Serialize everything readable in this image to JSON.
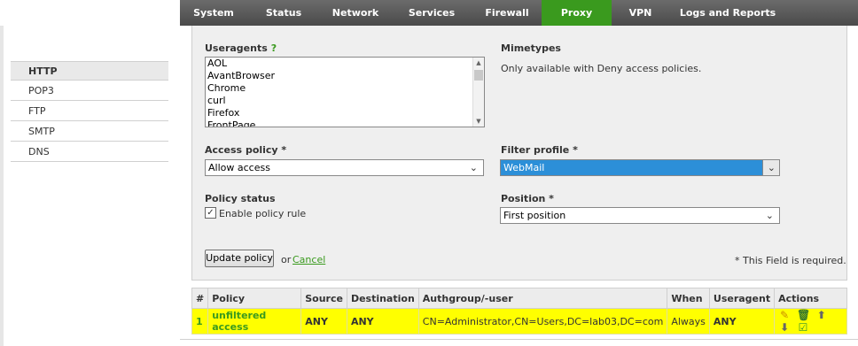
{
  "nav": {
    "items": [
      {
        "label": "System"
      },
      {
        "label": "Status"
      },
      {
        "label": "Network"
      },
      {
        "label": "Services"
      },
      {
        "label": "Firewall"
      },
      {
        "label": "Proxy",
        "active": true
      },
      {
        "label": "VPN"
      },
      {
        "label": "Logs and Reports"
      }
    ],
    "active_color": "#3a9a1e"
  },
  "sidebar": {
    "items": [
      {
        "label": "HTTP",
        "active": true
      },
      {
        "label": "POP3"
      },
      {
        "label": "FTP"
      },
      {
        "label": "SMTP"
      },
      {
        "label": "DNS"
      }
    ]
  },
  "form": {
    "useragents": {
      "label": "Useragents",
      "help": "?",
      "options": [
        "AOL",
        "AvantBrowser",
        "Chrome",
        "curl",
        "Firefox",
        "FrontPage"
      ]
    },
    "mimetypes": {
      "label": "Mimetypes",
      "note": "Only available with Deny access policies."
    },
    "access_policy": {
      "label": "Access policy *",
      "value": "Allow access"
    },
    "filter_profile": {
      "label": "Filter profile *",
      "value": "WebMail"
    },
    "policy_status": {
      "label": "Policy status",
      "checkbox_label": "Enable policy rule",
      "checked": true
    },
    "position": {
      "label": "Position *",
      "value": "First position"
    },
    "update_button": "Update policy",
    "or_text": "or",
    "cancel_link": "Cancel",
    "required_note": "* This Field is required."
  },
  "table": {
    "headers": [
      "#",
      "Policy",
      "Source",
      "Destination",
      "Authgroup/-user",
      "When",
      "Useragent",
      "Actions"
    ],
    "rows": [
      {
        "num": "1",
        "policy": "unfiltered access",
        "source": "ANY",
        "destination": "ANY",
        "authgroup": "CN=Administrator,CN=Users,DC=lab03,DC=com",
        "when": "Always",
        "useragent": "ANY",
        "actions": [
          "edit-icon",
          "delete-icon",
          "move-up-icon",
          "move-down-icon",
          "enabled-check-icon"
        ]
      }
    ],
    "highlight_color": "#ffff00"
  }
}
